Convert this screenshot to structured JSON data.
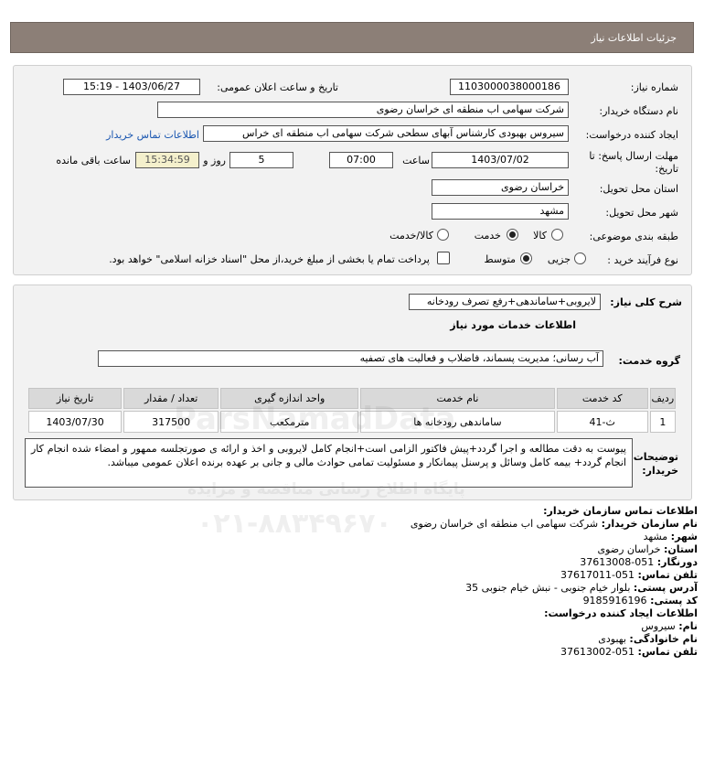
{
  "header": {
    "title": "جزئیات اطلاعات نیاز"
  },
  "form": {
    "need_number_label": "شماره نیاز:",
    "need_number": "1103000038000186",
    "announce_label": "تاریخ و ساعت اعلان عمومی:",
    "announce_value": "1403/06/27 - 15:19",
    "buyer_org_label": "نام دستگاه خریدار:",
    "buyer_org": "شرکت سهامی اب منطقه ای خراسان رضوی",
    "creator_label": "ایجاد کننده درخواست:",
    "creator": "سیروس  بهبودی کارشناس آبهای سطحی شرکت سهامی اب منطقه ای خراس",
    "contact_link": "اطلاعات تماس خریدار",
    "deadline_label_1": "مهلت ارسال پاسخ: تا",
    "deadline_label_2": "تاریخ:",
    "deadline_date": "1403/07/02",
    "time_label": "ساعت",
    "deadline_time": "07:00",
    "days": "5",
    "days_label": "روز و",
    "remaining_time": "15:34:59",
    "remaining_label": "ساعت باقی مانده",
    "province_label": "استان محل تحویل:",
    "province": "خراسان رضوی",
    "city_label": "شهر محل تحویل:",
    "city": "مشهد",
    "category_label": "طبقه بندی موضوعی:",
    "category_options": [
      "کالا",
      "خدمت",
      "کالا/خدمت"
    ],
    "category_selected": "خدمت",
    "process_label": "نوع فرآیند خرید :",
    "process_options": [
      "جزیی",
      "متوسط"
    ],
    "process_selected": "متوسط",
    "payment_note": "پرداخت تمام یا بخشی از مبلغ خرید،از محل \"اسناد خزانه اسلامی\" خواهد بود."
  },
  "details": {
    "summary_label": "شرح کلی نیاز:",
    "summary": "لایروبی+ساماندهی+رفع تصرف رودخانه",
    "services_heading": "اطلاعات خدمات مورد نیاز",
    "service_group_label": "گروه خدمت:",
    "service_group": "آب رسانی؛ مدیریت پسماند، فاضلاب و فعالیت های تصفیه",
    "table": {
      "headers": [
        "ردیف",
        "کد خدمت",
        "نام خدمت",
        "واحد اندازه گیری",
        "تعداد / مقدار",
        "تاریخ نیاز"
      ],
      "rows": [
        [
          "1",
          "ث-41",
          "ساماندهی رودخانه ها",
          "مترمکعب",
          "317500",
          "1403/07/30"
        ]
      ]
    },
    "buyer_notes_label_1": "توضیحات",
    "buyer_notes_label_2": "خریدار:",
    "buyer_notes": "پیوست به دقت مطالعه و اجرا گردد+پیش فاکتور الزامی است+انجام کامل لایروبی و اخذ و ارائه ی صورتجلسه ممهور و امضاء شده انجام کار انجام گردد+ بیمه کامل وسائل و پرسنل پیمانکار و مسئولیت تمامی حوادث مالی و جانی بر عهده برنده اعلان عمومی میباشد."
  },
  "contact": {
    "heading": "اطلاعات تماس سازمان خریدار:",
    "org_label": "نام سازمان خریدار:",
    "org": "شرکت سهامی اب منطقه ای خراسان رضوی",
    "city_label": "شهر:",
    "city": "مشهد",
    "province_label": "استان:",
    "province": "خراسان رضوی",
    "fax_label": "دورنگار:",
    "fax": "051-37613008",
    "phone_label": "تلفن تماس:",
    "phone": "051-37617011",
    "address_label": "آدرس پستی:",
    "address": "بلوار خیام جنوبی - نبش خیام جنوبی 35",
    "postal_label": "کد پستی:",
    "postal": "9185916196",
    "creator_heading": "اطلاعات ایجاد کننده درخواست:",
    "name_label": "نام:",
    "name": "سیروس",
    "family_label": "نام خانوادگی:",
    "family": "بهبودی",
    "creator_phone_label": "تلفن تماس:",
    "creator_phone": "051-37613002"
  },
  "watermark": {
    "brand": "ParsNamadData",
    "tagline": "پایگاه اطلاع رسانی مناقصه و مزایده",
    "phone": "۰۲۱-۸۸۳۴۹۶۷۰"
  }
}
